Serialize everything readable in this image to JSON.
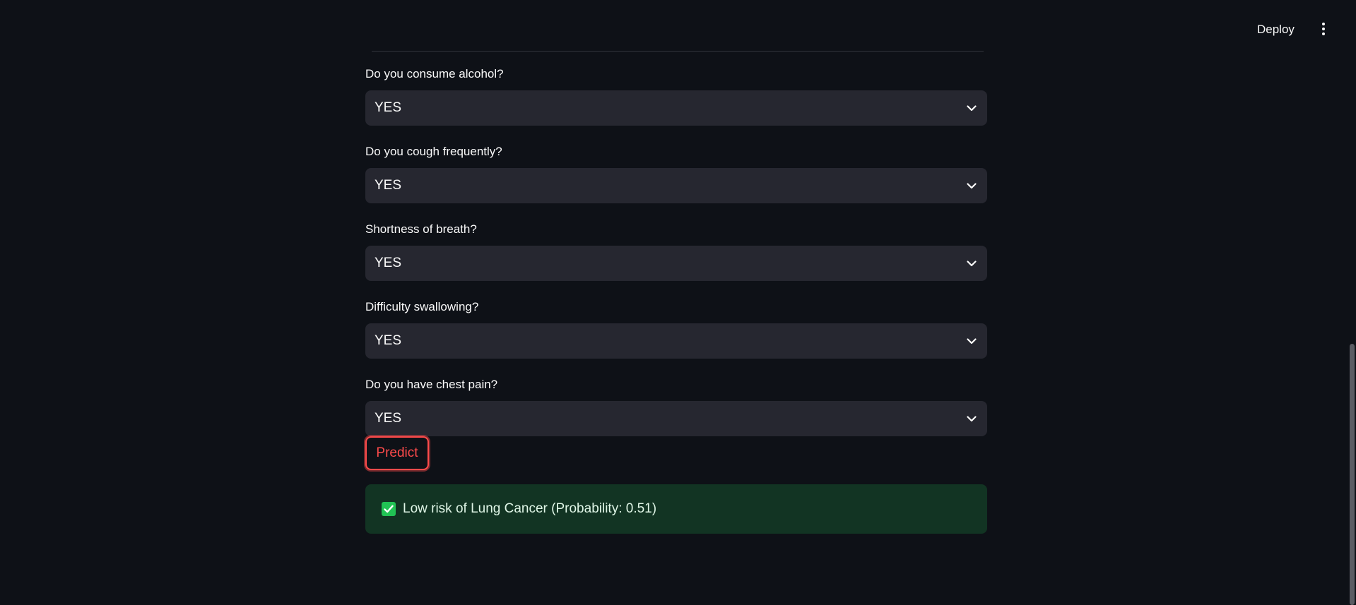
{
  "header": {
    "deploy_label": "Deploy",
    "menu_icon": "more-vertical-icon"
  },
  "form": {
    "fields": [
      {
        "label": "Do you consume alcohol?",
        "value": "YES"
      },
      {
        "label": "Do you cough frequently?",
        "value": "YES"
      },
      {
        "label": "Shortness of breath?",
        "value": "YES"
      },
      {
        "label": "Difficulty swallowing?",
        "value": "YES"
      },
      {
        "label": "Do you have chest pain?",
        "value": "YES"
      }
    ],
    "predict_label": "Predict"
  },
  "result": {
    "icon": "check-box-icon",
    "text": "Low risk of Lung Cancer (Probability: 0.51)"
  },
  "colors": {
    "background": "#0e1117",
    "accent": "#ff4b4b",
    "select_bg": "#262730",
    "success": "#21c354"
  }
}
